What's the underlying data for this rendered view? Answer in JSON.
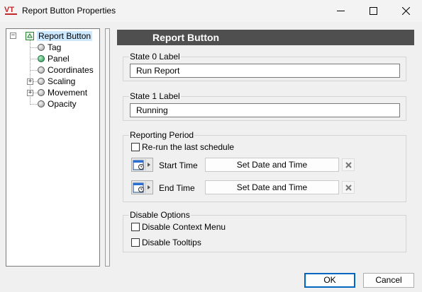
{
  "window": {
    "title": "Report Button Properties",
    "icon": "vt-scada-logo-icon"
  },
  "tree": {
    "root": {
      "label": "Report Button",
      "expander": "−"
    },
    "items": [
      {
        "label": "Tag",
        "state": "normal"
      },
      {
        "label": "Panel",
        "state": "active"
      },
      {
        "label": "Coordinates",
        "state": "normal"
      },
      {
        "label": "Scaling",
        "state": "normal",
        "expander": "+"
      },
      {
        "label": "Movement",
        "state": "normal",
        "expander": "+"
      },
      {
        "label": "Opacity",
        "state": "normal"
      }
    ]
  },
  "header": {
    "title": "Report Button"
  },
  "state0": {
    "label": "State 0 Label",
    "value": "Run Report"
  },
  "state1": {
    "label": "State 1 Label",
    "value": "Running"
  },
  "reporting": {
    "label": "Reporting Period",
    "rerun_label": "Re-run the last schedule",
    "rerun_checked": false,
    "start_label": "Start Time",
    "end_label": "End Time",
    "set_button": "Set Date and Time"
  },
  "disable": {
    "label": "Disable Options",
    "context_menu_label": "Disable Context Menu",
    "context_menu_checked": false,
    "tooltips_label": "Disable Tooltips",
    "tooltips_checked": false
  },
  "footer": {
    "ok": "OK",
    "cancel": "Cancel"
  },
  "colors": {
    "header_bg": "#4f4f4f",
    "selection": "#cce8ff",
    "default_button_border": "#0067c0",
    "active_node": "#1f8f4e"
  }
}
